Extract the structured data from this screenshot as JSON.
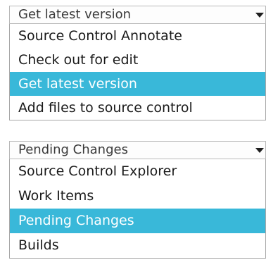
{
  "colors": {
    "selection_bg": "#39b8d9",
    "selection_text": "#ffffff",
    "text": "#1a1a1a",
    "border": "#a8a8a8"
  },
  "dropdowns": [
    {
      "selected_value": "Get latest version",
      "arrow_icon": "chevron-down-icon",
      "items": [
        {
          "label": "Source Control Annotate",
          "selected": false
        },
        {
          "label": "Check out for edit",
          "selected": false
        },
        {
          "label": "Get latest version",
          "selected": true
        },
        {
          "label": "Add files to source control",
          "selected": false
        }
      ]
    },
    {
      "selected_value": "Pending Changes",
      "arrow_icon": "chevron-down-icon",
      "items": [
        {
          "label": "Source Control Explorer",
          "selected": false
        },
        {
          "label": "Work Items",
          "selected": false
        },
        {
          "label": "Pending Changes",
          "selected": true
        },
        {
          "label": "Builds",
          "selected": false
        }
      ]
    }
  ]
}
